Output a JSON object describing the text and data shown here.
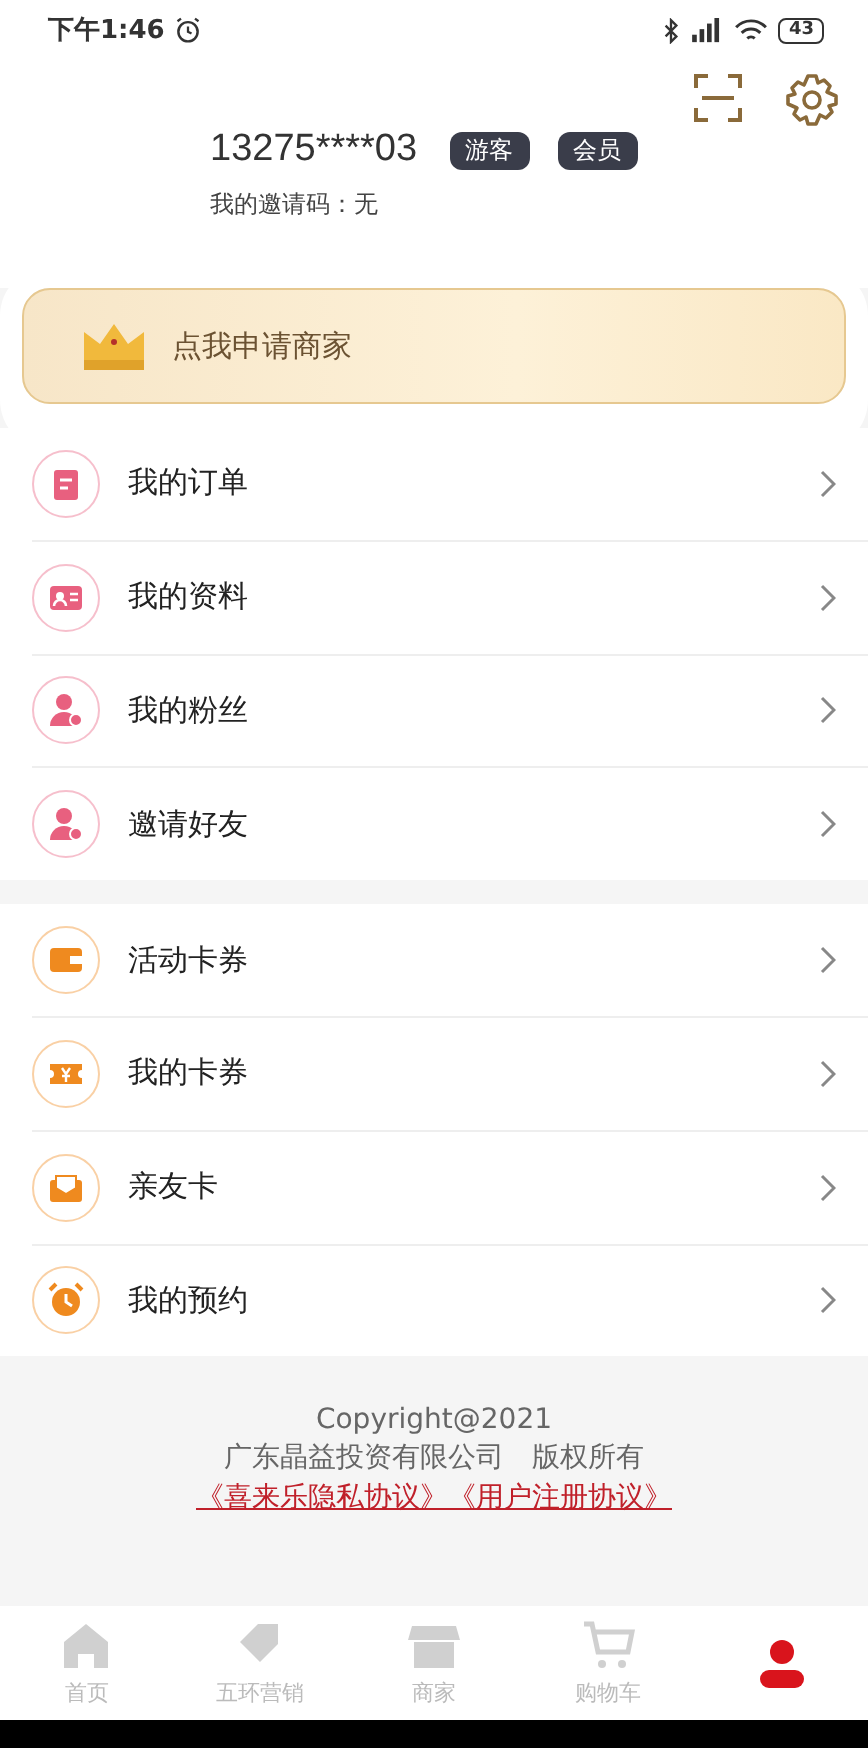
{
  "status_bar": {
    "time": "下午1:46",
    "battery": "43"
  },
  "profile": {
    "phone": "13275****03",
    "badges": [
      "游客",
      "会员"
    ],
    "invite_code": "我的邀请码：无"
  },
  "merchant_banner": {
    "label": "点我申请商家"
  },
  "menu_groups": [
    {
      "color": "#e8607f",
      "items": [
        {
          "kind": "clipboard",
          "label": "我的订单"
        },
        {
          "kind": "idcard",
          "label": "我的资料"
        },
        {
          "kind": "fans",
          "label": "我的粉丝"
        },
        {
          "kind": "invite",
          "label": "邀请好友"
        }
      ]
    },
    {
      "color": "#ef8a1f",
      "items": [
        {
          "kind": "wallet",
          "label": "活动卡券"
        },
        {
          "kind": "ticket",
          "label": "我的卡券"
        },
        {
          "kind": "envelope",
          "label": "亲友卡"
        },
        {
          "kind": "alarm",
          "label": "我的预约"
        }
      ]
    }
  ],
  "footer": {
    "copyright": "Copyright@2021",
    "company": "广东晶益投资有限公司　版权所有",
    "links": [
      "《喜来乐隐私协议》",
      "《用户注册协议》"
    ]
  },
  "tab_bar": [
    {
      "kind": "home",
      "label": "首页",
      "selected": false
    },
    {
      "kind": "tag",
      "label": "五环营销",
      "selected": false
    },
    {
      "kind": "shop",
      "label": "商家",
      "selected": false
    },
    {
      "kind": "cart",
      "label": "购物车",
      "selected": false
    },
    {
      "kind": "user",
      "selected": true
    }
  ]
}
